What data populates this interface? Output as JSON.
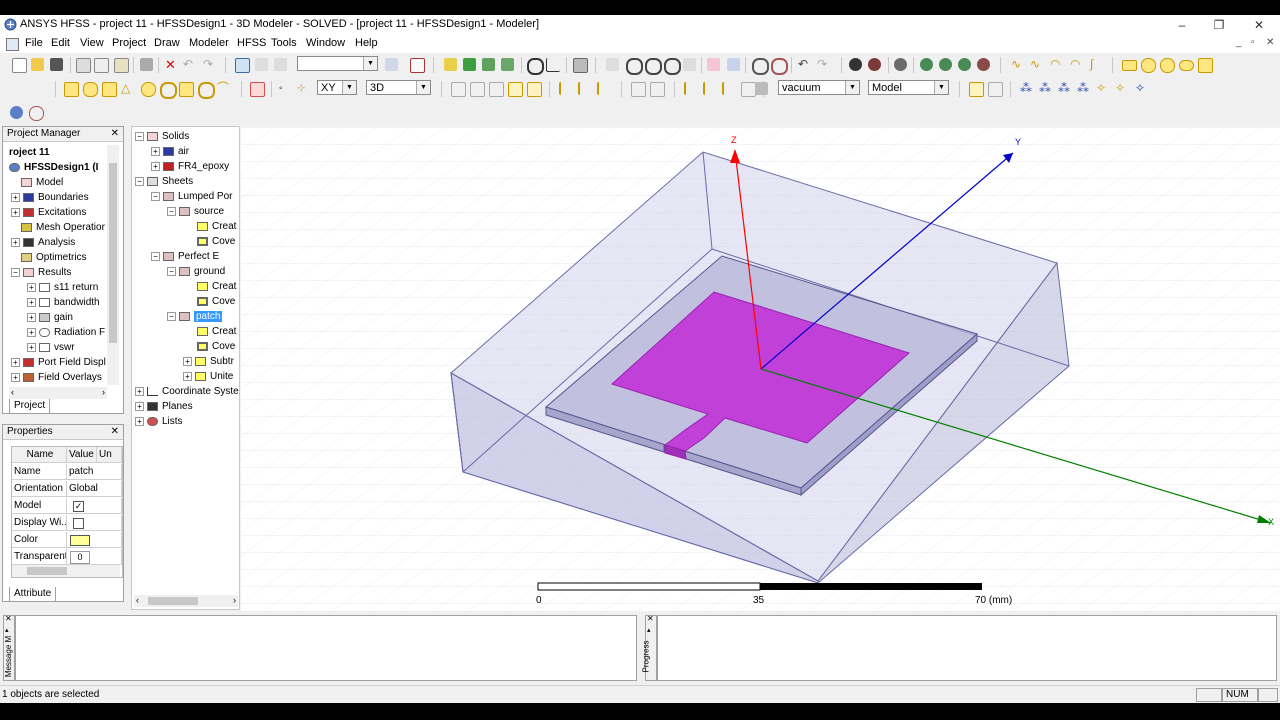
{
  "window": {
    "title": "ANSYS HFSS - project 11 - HFSSDesign1 - 3D Modeler - SOLVED - [project 11 - HFSSDesign1 - Modeler]"
  },
  "menu": {
    "items": [
      "File",
      "Edit",
      "View",
      "Project",
      "Draw",
      "Modeler",
      "HFSS",
      "Tools",
      "Window",
      "Help"
    ]
  },
  "toolbar": {
    "plane": "XY",
    "dimension": "3D",
    "material": "vacuum",
    "model_mode": "Model"
  },
  "project_manager": {
    "title": "Project Manager",
    "tab": "Project",
    "items": [
      {
        "label": "roject 11",
        "bold": true
      },
      {
        "label": "HFSSDesign1 (I",
        "bold": true
      },
      {
        "label": "Model"
      },
      {
        "label": "Boundaries"
      },
      {
        "label": "Excitations"
      },
      {
        "label": "Mesh Operatior"
      },
      {
        "label": "Analysis"
      },
      {
        "label": "Optimetrics"
      },
      {
        "label": "Results"
      },
      {
        "label": "s11 return"
      },
      {
        "label": "bandwidth"
      },
      {
        "label": "gain"
      },
      {
        "label": "Radiation F"
      },
      {
        "label": "vswr"
      },
      {
        "label": "Port Field Displ"
      },
      {
        "label": "Field Overlays"
      }
    ]
  },
  "properties": {
    "title": "Properties",
    "tab": "Attribute",
    "headers": [
      "Name",
      "Value",
      "Un"
    ],
    "rows": [
      {
        "name": "Name",
        "value": "patch"
      },
      {
        "name": "Orientation",
        "value": "Global"
      },
      {
        "name": "Model",
        "value": "✓"
      },
      {
        "name": "Display Wi...",
        "value": ""
      },
      {
        "name": "Color",
        "value": ""
      },
      {
        "name": "Transparent",
        "value": "0"
      }
    ],
    "color_swatch": "#ffff99"
  },
  "model_tree": {
    "items": [
      {
        "label": "Solids"
      },
      {
        "label": "air"
      },
      {
        "label": "FR4_epoxy"
      },
      {
        "label": "Sheets"
      },
      {
        "label": "Lumped Por"
      },
      {
        "label": "source"
      },
      {
        "label": "Creat"
      },
      {
        "label": "Cove"
      },
      {
        "label": "Perfect E"
      },
      {
        "label": "ground"
      },
      {
        "label": "Creat"
      },
      {
        "label": "Cove"
      },
      {
        "label": "patch"
      },
      {
        "label": "Creat"
      },
      {
        "label": "Cove"
      },
      {
        "label": "Subtr"
      },
      {
        "label": "Unite"
      },
      {
        "label": "Coordinate Syste"
      },
      {
        "label": "Planes"
      },
      {
        "label": "Lists"
      }
    ]
  },
  "viewport": {
    "axes": {
      "z": "Z",
      "y": "Y",
      "x": "X"
    },
    "scale": {
      "labels": [
        "0",
        "35",
        "70 (mm)"
      ]
    },
    "colors": {
      "patch": "#c040d8",
      "axis_x": "#008000",
      "axis_y": "#0000cc",
      "axis_z": "#ff0000",
      "airbox": "#c8c8e6"
    }
  },
  "bottom": {
    "message_tab": "Message M",
    "progress_tab": "Progress"
  },
  "status": {
    "text": "1 objects are selected",
    "num": "NUM"
  }
}
